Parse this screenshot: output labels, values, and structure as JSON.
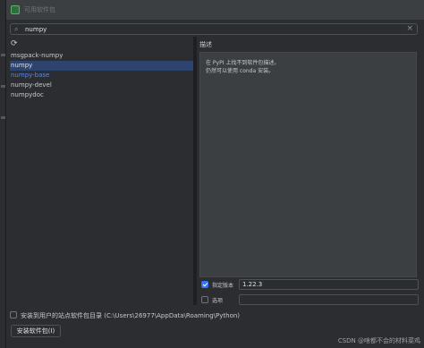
{
  "window": {
    "title": "可用软件包"
  },
  "search": {
    "value": "numpy",
    "icon": "search-icon",
    "clear_icon": "close-icon"
  },
  "toolbar": {
    "refresh_icon": "refresh-icon"
  },
  "packages": [
    {
      "name": "msgpack-numpy"
    },
    {
      "name": "numpy",
      "selected": true
    },
    {
      "name": "numpy-base",
      "color": "#548af7"
    },
    {
      "name": "numpy-devel"
    },
    {
      "name": "numpydoc"
    }
  ],
  "description": {
    "label": "描述",
    "lines": [
      "在 PyPI 上找不到软件包描述。",
      "仍然可以使用 conda 安装。"
    ]
  },
  "options": {
    "version": {
      "label": "指定版本",
      "checked": true,
      "value": "1.22.3"
    },
    "extra": {
      "label": "选项",
      "checked": false,
      "value": ""
    }
  },
  "install_user": {
    "label": "安装到用户的站点软件包目录 (C:\\Users\\26977\\AppData\\Roaming\\Python)",
    "checked": false
  },
  "install_button": {
    "label": "安装软件包(I)"
  },
  "watermark": "CSDN @啥都不会的材料菜鸡",
  "colors": {
    "accent": "#3574f0",
    "selection": "#2e436e",
    "link": "#548af7"
  }
}
